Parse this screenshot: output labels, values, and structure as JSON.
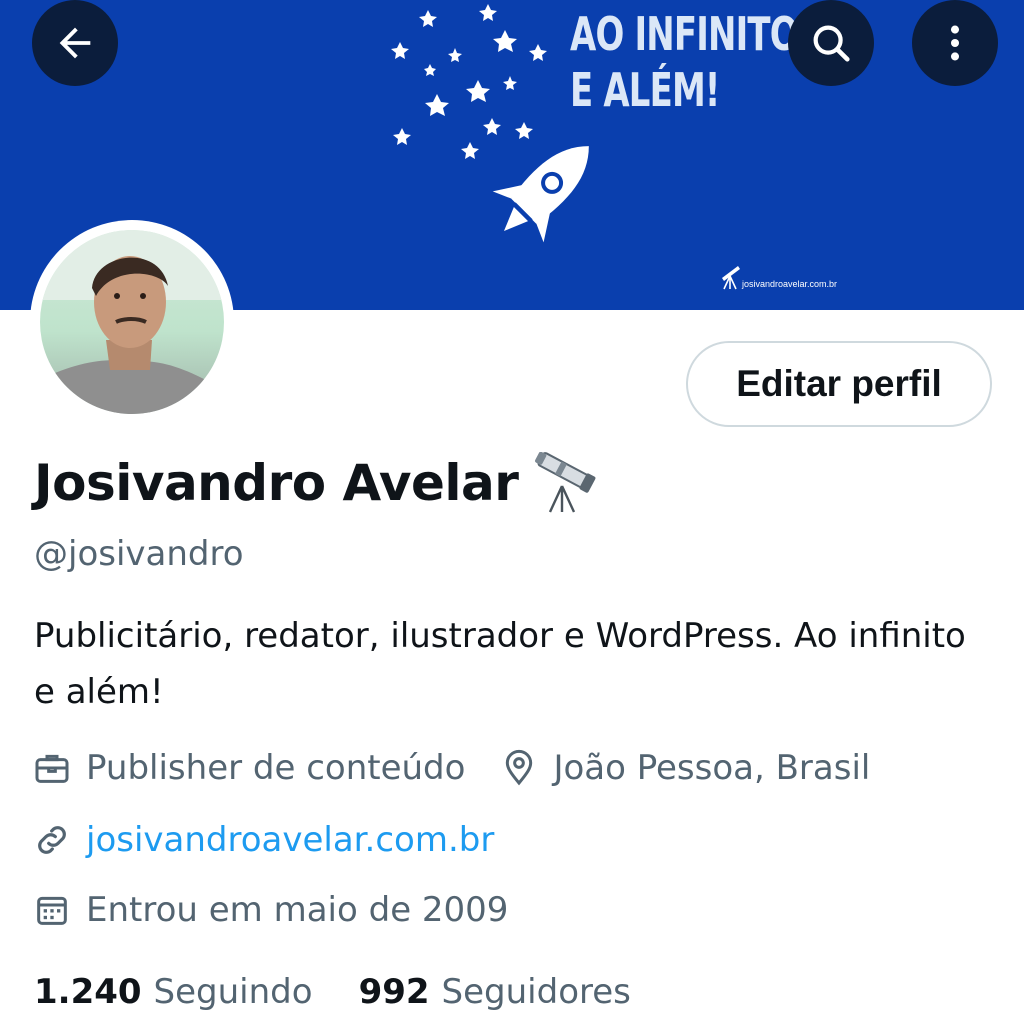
{
  "header": {
    "back_icon": "arrow-left-icon",
    "search_icon": "search-icon",
    "more_icon": "more-vertical-icon"
  },
  "banner": {
    "headline_line1": "AO INFINITO",
    "headline_line2": "E ALÉM!",
    "site": "josivandroavelar.com.br",
    "color": "#0a3fae"
  },
  "profile": {
    "display_name": "Josivandro Avelar",
    "name_emoji": "telescope-icon",
    "handle": "@josivandro",
    "bio": "Publicitário, redator, ilustrador e WordPress. Ao infinito e além!",
    "edit_button": "Editar perfil",
    "profession": "Publisher de conteúdo",
    "location": "João Pessoa, Brasil",
    "website": "josivandroavelar.com.br",
    "joined": "Entrou em maio de 2009"
  },
  "stats": {
    "following_count": "1.240",
    "following_label": "Seguindo",
    "followers_count": "992",
    "followers_label": "Seguidores"
  },
  "colors": {
    "link": "#1d9bf0",
    "secondary_text": "#536471",
    "primary_text": "#0f1419"
  }
}
